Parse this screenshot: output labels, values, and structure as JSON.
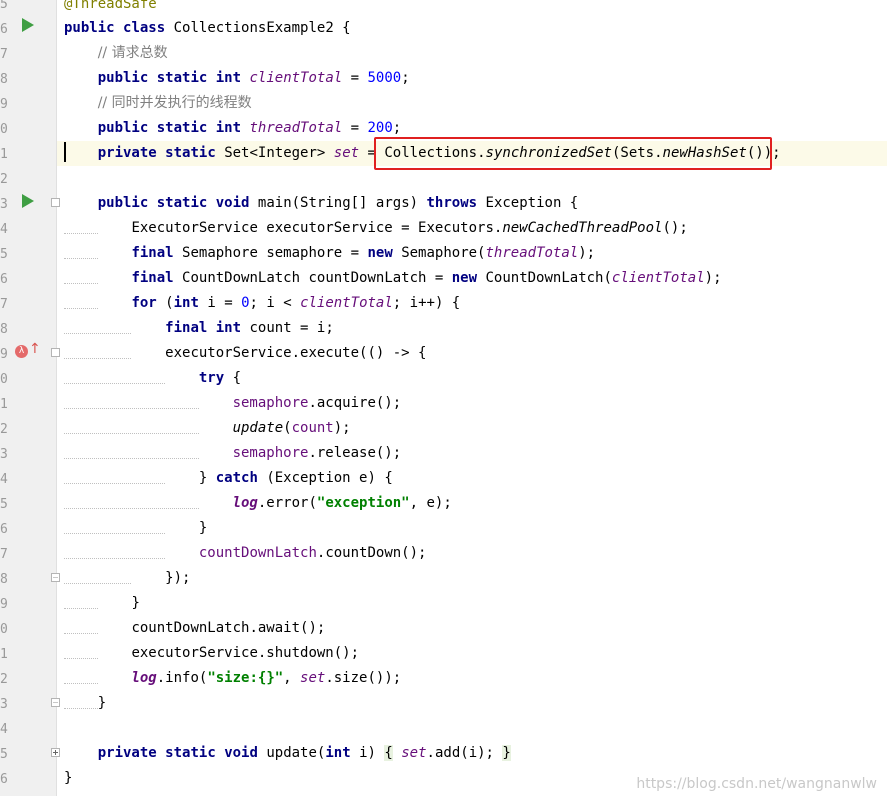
{
  "gutter": {
    "line_numbers": [
      "5",
      "6",
      "7",
      "8",
      "9",
      "0",
      "1",
      "2",
      "3",
      "4",
      "5",
      "6",
      "7",
      "8",
      "9",
      "0",
      "1",
      "2",
      "3",
      "4",
      "5",
      "6",
      "7",
      "8",
      "9",
      "0",
      "1",
      "2",
      "3",
      "4",
      "5",
      "6"
    ]
  },
  "code": {
    "l5": {
      "ann": "@ThreadSafe"
    },
    "l6": {
      "kw1": "public",
      "kw2": "class",
      "name": "CollectionsExample2 {"
    },
    "l7": {
      "comment": "// 请求总数"
    },
    "l8": {
      "kw1": "public",
      "kw2": "static",
      "kw3": "int",
      "field": "clientTotal",
      "eq": " = ",
      "num": "5000",
      "end": ";"
    },
    "l9": {
      "comment": "// 同时并发执行的线程数"
    },
    "l10": {
      "kw1": "public",
      "kw2": "static",
      "kw3": "int",
      "field": "threadTotal",
      "eq": " = ",
      "num": "200",
      "end": ";"
    },
    "l11": {
      "kw1": "private",
      "kw2": "static",
      "type": "Set<Integer>",
      "field": "set",
      "eq": " = ",
      "a": "Collections.",
      "b": "synchronizedSet",
      "c": "(Sets.",
      "d": "newHashSet",
      "e": "());"
    },
    "l13": {
      "kw1": "public",
      "kw2": "static",
      "kw3": "void",
      "sig": "main(String[] args)",
      "kw4": "throws",
      "rest": "Exception {"
    },
    "l14": {
      "a": "ExecutorService executorService = Executors.",
      "b": "newCachedThreadPool",
      "c": "();"
    },
    "l15": {
      "kw1": "final",
      "a": "Semaphore semaphore = ",
      "kw2": "new",
      "b": "Semaphore(",
      "field": "threadTotal",
      "c": ");"
    },
    "l16": {
      "kw1": "final",
      "a": "CountDownLatch countDownLatch = ",
      "kw2": "new",
      "b": "CountDownLatch(",
      "field": "clientTotal",
      "c": ");"
    },
    "l17": {
      "kw1": "for",
      "a": "(",
      "kw2": "int",
      "b": " i = ",
      "num": "0",
      "c": "; i < ",
      "field": "clientTotal",
      "d": "; i++) {"
    },
    "l18": {
      "kw1": "final",
      "kw2": "int",
      "a": "count = i;"
    },
    "l19": {
      "a": "executorService.execute(() -> {"
    },
    "l20": {
      "kw1": "try",
      "a": " {"
    },
    "l21": {
      "var": "semaphore",
      "a": ".acquire();"
    },
    "l22": {
      "fn": "update",
      "a": "(",
      "var": "count",
      "b": ");"
    },
    "l23": {
      "var": "semaphore",
      "a": ".release();"
    },
    "l24": {
      "a": "} ",
      "kw1": "catch",
      "b": " (Exception e) {"
    },
    "l25": {
      "log": "log",
      "a": ".error(",
      "str": "\"exception\"",
      "b": ", e);"
    },
    "l26": {
      "a": "}"
    },
    "l27": {
      "var": "countDownLatch",
      "a": ".countDown();"
    },
    "l28": {
      "a": "});"
    },
    "l29": {
      "a": "}"
    },
    "l30": {
      "a": "countDownLatch.await();"
    },
    "l31": {
      "a": "executorService.shutdown();"
    },
    "l32": {
      "log": "log",
      "a": ".info(",
      "str": "\"size:{}\"",
      "b": ", ",
      "field": "set",
      "c": ".size());"
    },
    "l33": {
      "a": "}"
    },
    "l35": {
      "kw1": "private",
      "kw2": "static",
      "kw3": "void",
      "a": "update(",
      "kw4": "int",
      "b": " i) ",
      "o": "{",
      "field": "set",
      "c": ".add(i); ",
      "cl": "}"
    },
    "l36": {
      "a": "}"
    }
  },
  "watermark": "https://blog.csdn.net/wangnanwlw"
}
